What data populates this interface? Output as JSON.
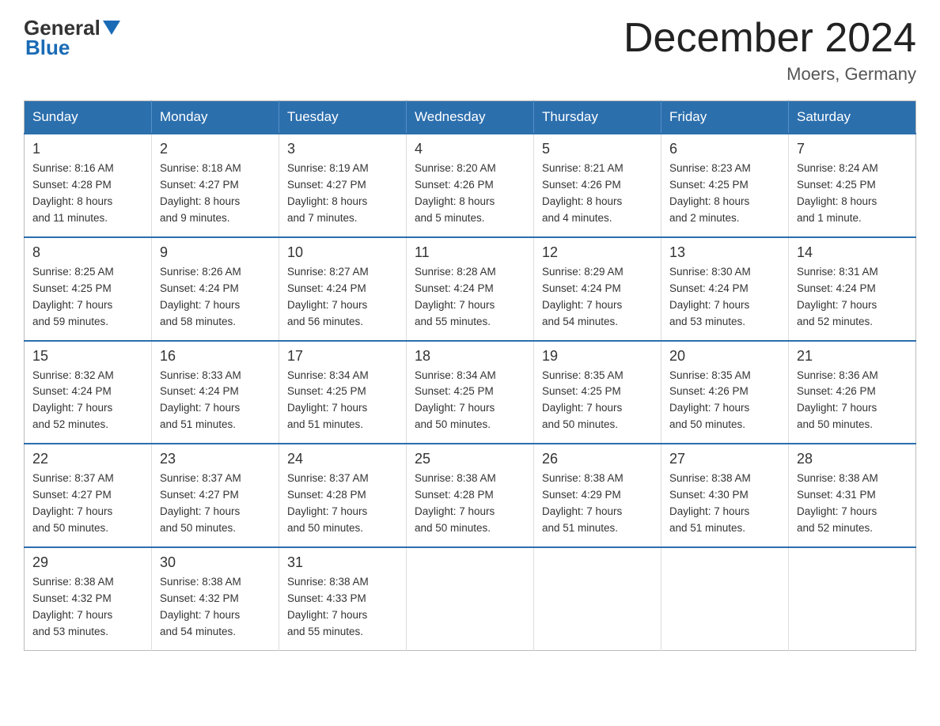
{
  "header": {
    "logo_general": "General",
    "logo_blue": "Blue",
    "month_title": "December 2024",
    "location": "Moers, Germany"
  },
  "days_of_week": [
    "Sunday",
    "Monday",
    "Tuesday",
    "Wednesday",
    "Thursday",
    "Friday",
    "Saturday"
  ],
  "weeks": [
    [
      {
        "day": "1",
        "info": "Sunrise: 8:16 AM\nSunset: 4:28 PM\nDaylight: 8 hours\nand 11 minutes."
      },
      {
        "day": "2",
        "info": "Sunrise: 8:18 AM\nSunset: 4:27 PM\nDaylight: 8 hours\nand 9 minutes."
      },
      {
        "day": "3",
        "info": "Sunrise: 8:19 AM\nSunset: 4:27 PM\nDaylight: 8 hours\nand 7 minutes."
      },
      {
        "day": "4",
        "info": "Sunrise: 8:20 AM\nSunset: 4:26 PM\nDaylight: 8 hours\nand 5 minutes."
      },
      {
        "day": "5",
        "info": "Sunrise: 8:21 AM\nSunset: 4:26 PM\nDaylight: 8 hours\nand 4 minutes."
      },
      {
        "day": "6",
        "info": "Sunrise: 8:23 AM\nSunset: 4:25 PM\nDaylight: 8 hours\nand 2 minutes."
      },
      {
        "day": "7",
        "info": "Sunrise: 8:24 AM\nSunset: 4:25 PM\nDaylight: 8 hours\nand 1 minute."
      }
    ],
    [
      {
        "day": "8",
        "info": "Sunrise: 8:25 AM\nSunset: 4:25 PM\nDaylight: 7 hours\nand 59 minutes."
      },
      {
        "day": "9",
        "info": "Sunrise: 8:26 AM\nSunset: 4:24 PM\nDaylight: 7 hours\nand 58 minutes."
      },
      {
        "day": "10",
        "info": "Sunrise: 8:27 AM\nSunset: 4:24 PM\nDaylight: 7 hours\nand 56 minutes."
      },
      {
        "day": "11",
        "info": "Sunrise: 8:28 AM\nSunset: 4:24 PM\nDaylight: 7 hours\nand 55 minutes."
      },
      {
        "day": "12",
        "info": "Sunrise: 8:29 AM\nSunset: 4:24 PM\nDaylight: 7 hours\nand 54 minutes."
      },
      {
        "day": "13",
        "info": "Sunrise: 8:30 AM\nSunset: 4:24 PM\nDaylight: 7 hours\nand 53 minutes."
      },
      {
        "day": "14",
        "info": "Sunrise: 8:31 AM\nSunset: 4:24 PM\nDaylight: 7 hours\nand 52 minutes."
      }
    ],
    [
      {
        "day": "15",
        "info": "Sunrise: 8:32 AM\nSunset: 4:24 PM\nDaylight: 7 hours\nand 52 minutes."
      },
      {
        "day": "16",
        "info": "Sunrise: 8:33 AM\nSunset: 4:24 PM\nDaylight: 7 hours\nand 51 minutes."
      },
      {
        "day": "17",
        "info": "Sunrise: 8:34 AM\nSunset: 4:25 PM\nDaylight: 7 hours\nand 51 minutes."
      },
      {
        "day": "18",
        "info": "Sunrise: 8:34 AM\nSunset: 4:25 PM\nDaylight: 7 hours\nand 50 minutes."
      },
      {
        "day": "19",
        "info": "Sunrise: 8:35 AM\nSunset: 4:25 PM\nDaylight: 7 hours\nand 50 minutes."
      },
      {
        "day": "20",
        "info": "Sunrise: 8:35 AM\nSunset: 4:26 PM\nDaylight: 7 hours\nand 50 minutes."
      },
      {
        "day": "21",
        "info": "Sunrise: 8:36 AM\nSunset: 4:26 PM\nDaylight: 7 hours\nand 50 minutes."
      }
    ],
    [
      {
        "day": "22",
        "info": "Sunrise: 8:37 AM\nSunset: 4:27 PM\nDaylight: 7 hours\nand 50 minutes."
      },
      {
        "day": "23",
        "info": "Sunrise: 8:37 AM\nSunset: 4:27 PM\nDaylight: 7 hours\nand 50 minutes."
      },
      {
        "day": "24",
        "info": "Sunrise: 8:37 AM\nSunset: 4:28 PM\nDaylight: 7 hours\nand 50 minutes."
      },
      {
        "day": "25",
        "info": "Sunrise: 8:38 AM\nSunset: 4:28 PM\nDaylight: 7 hours\nand 50 minutes."
      },
      {
        "day": "26",
        "info": "Sunrise: 8:38 AM\nSunset: 4:29 PM\nDaylight: 7 hours\nand 51 minutes."
      },
      {
        "day": "27",
        "info": "Sunrise: 8:38 AM\nSunset: 4:30 PM\nDaylight: 7 hours\nand 51 minutes."
      },
      {
        "day": "28",
        "info": "Sunrise: 8:38 AM\nSunset: 4:31 PM\nDaylight: 7 hours\nand 52 minutes."
      }
    ],
    [
      {
        "day": "29",
        "info": "Sunrise: 8:38 AM\nSunset: 4:32 PM\nDaylight: 7 hours\nand 53 minutes."
      },
      {
        "day": "30",
        "info": "Sunrise: 8:38 AM\nSunset: 4:32 PM\nDaylight: 7 hours\nand 54 minutes."
      },
      {
        "day": "31",
        "info": "Sunrise: 8:38 AM\nSunset: 4:33 PM\nDaylight: 7 hours\nand 55 minutes."
      },
      null,
      null,
      null,
      null
    ]
  ]
}
